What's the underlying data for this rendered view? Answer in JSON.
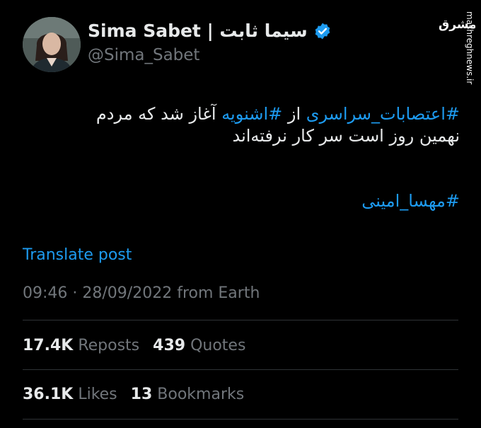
{
  "author": {
    "name": "Sima Sabet | سیما ثابت",
    "handle": "@Sima_Sabet",
    "verified": true
  },
  "watermark": {
    "logo_text": "مشرق",
    "site": "mashreghnews.ir"
  },
  "tweet": {
    "hashtag_1": "#اعتصابات_سراسری",
    "text_from": " از ",
    "hashtag_2": "#اشنویه",
    "text_rest": " آغاز شد که مردم",
    "line2": "نهمین روز است سر کار نرفته‌اند",
    "hashtag_3": "#مهسا_امینی"
  },
  "translate_label": "Translate post",
  "meta": {
    "time": "09:46",
    "separator": " · ",
    "date": "28/09/2022",
    "source": " from Earth"
  },
  "stats": {
    "reposts_count": "17.4K",
    "reposts_label": " Reposts",
    "quotes_count": "439",
    "quotes_label": " Quotes",
    "likes_count": "36.1K",
    "likes_label": " Likes",
    "bookmarks_count": "13",
    "bookmarks_label": " Bookmarks"
  },
  "colors": {
    "background": "#000000",
    "text": "#e7e9ea",
    "muted": "#71767b",
    "accent": "#1d9bf0",
    "divider": "#2f3336"
  }
}
